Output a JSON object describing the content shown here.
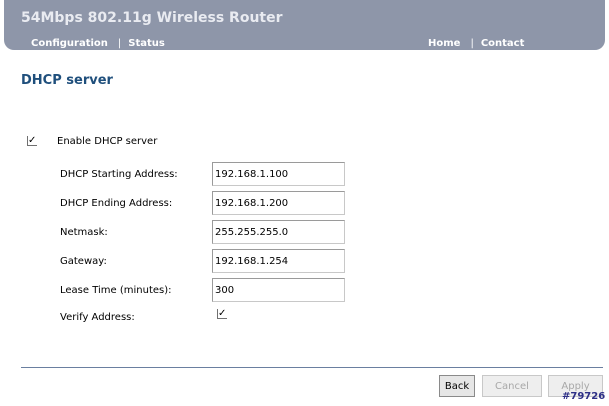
{
  "header": {
    "title": "54Mbps 802.11g Wireless Router",
    "nav_left": [
      {
        "label": "Configuration"
      },
      {
        "label": "Status"
      }
    ],
    "nav_right": [
      {
        "label": "Home"
      },
      {
        "label": "Contact"
      }
    ],
    "separator": "|"
  },
  "page": {
    "title": "DHCP server",
    "enable": {
      "label": "Enable DHCP server",
      "checked": true,
      "mark": "✓"
    },
    "fields": [
      {
        "label": "DHCP Starting Address:",
        "value": "192.168.1.100"
      },
      {
        "label": "DHCP Ending Address:",
        "value": "192.168.1.200"
      },
      {
        "label": "Netmask:",
        "value": "255.255.255.0"
      },
      {
        "label": "Gateway:",
        "value": "192.168.1.254"
      },
      {
        "label": "Lease Time (minutes):",
        "value": "300"
      }
    ],
    "verify": {
      "label": "Verify Address:",
      "checked": true,
      "mark": "✓"
    }
  },
  "buttons": {
    "back": "Back",
    "cancel": "Cancel",
    "apply": "Apply"
  },
  "reference_id": "#79726",
  "colors": {
    "header": "#8e96a9",
    "title": "#1f4f7c",
    "divider": "#6a7fa0"
  }
}
